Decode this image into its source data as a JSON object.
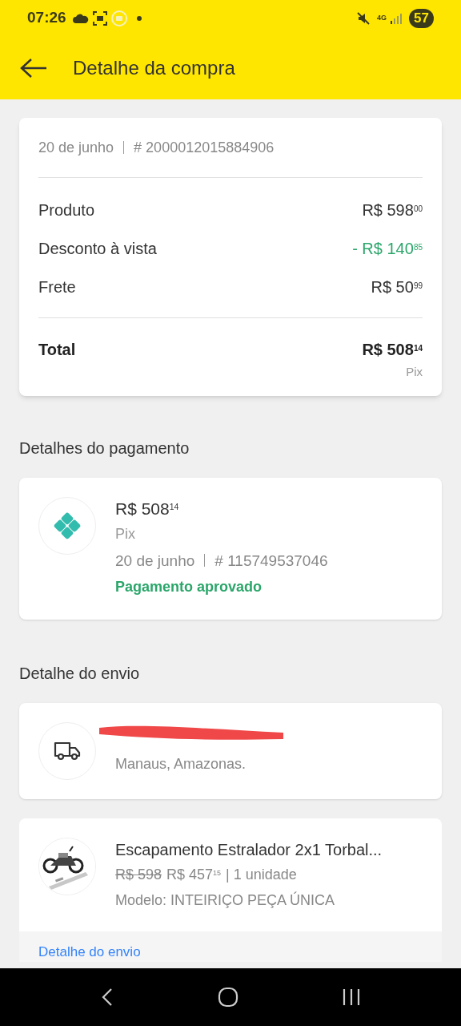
{
  "status_bar": {
    "time": "07:26",
    "network": "4G",
    "battery": "57"
  },
  "header": {
    "title": "Detalhe da compra"
  },
  "summary": {
    "date": "20 de junho",
    "order": "# 2000012015884906",
    "lines": [
      {
        "kind": "normal",
        "label": "Produto",
        "value": "R$ 598$^{00}$"
      },
      {
        "kind": "discount",
        "label": "Desconto à vista",
        "value": "- R$ 140$^{85}$"
      },
      {
        "kind": "normal",
        "label": "Frete",
        "value": "R$ 50$^{99}$"
      }
    ],
    "total": {
      "label": "Total",
      "value": "R$ 508$^{14}$",
      "method": "Pix"
    }
  },
  "payment": {
    "title": "Detalhes do pagamento",
    "amount": "R$ 508$^{14}$",
    "method": "Pix",
    "date": "20 de junho",
    "id": "# 115749537046",
    "status": "Pagamento aprovado"
  },
  "shipping": {
    "title": "Detalhe do envio",
    "city": "Manaus, Amazonas.",
    "redacted": true
  },
  "item": {
    "title": "Escapamento Estralador 2x1 Torbal...",
    "old_price": "R$ 598",
    "price": "R$ 457$^{15}$",
    "quantity": "| 1 unidade",
    "model": "Modelo: INTEIRIÇO PEÇA ÚNICA"
  },
  "link": "Detalhe do envio"
}
